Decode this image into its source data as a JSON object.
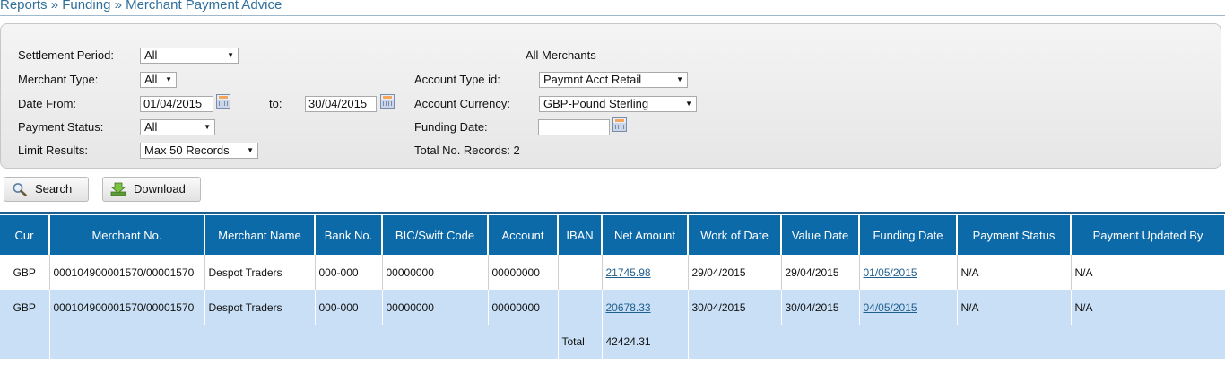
{
  "breadcrumb": "Reports » Funding » Merchant Payment Advice",
  "filters": {
    "settlement_period": {
      "label": "Settlement Period:",
      "value": "All"
    },
    "merchant_type": {
      "label": "Merchant Type:",
      "value": "All"
    },
    "date_from": {
      "label": "Date From:",
      "value": "01/04/2015"
    },
    "date_to": {
      "label": "to:",
      "value": "30/04/2015"
    },
    "payment_status": {
      "label": "Payment Status:",
      "value": "All"
    },
    "limit_results": {
      "label": "Limit Results:",
      "value": "Max 50 Records"
    },
    "all_merchants": "All Merchants",
    "account_type": {
      "label": "Account Type id:",
      "value": "Paymnt Acct Retail"
    },
    "account_currency": {
      "label": "Account Currency:",
      "value": "GBP-Pound Sterling"
    },
    "funding_date": {
      "label": "Funding Date:",
      "value": ""
    },
    "total_records": "Total No. Records: 2"
  },
  "buttons": {
    "search": "Search",
    "download": "Download"
  },
  "table": {
    "headers": [
      "Cur",
      "Merchant No.",
      "Merchant Name",
      "Bank No.",
      "BIC/Swift Code",
      "Account",
      "IBAN",
      "Net Amount",
      "Work of Date",
      "Value Date",
      "Funding Date",
      "Payment Status",
      "Payment Updated By"
    ],
    "rows": [
      {
        "cur": "GBP",
        "merchant_no": "000104900001570/00001570",
        "merchant_name": "Despot Traders",
        "bank_no": "000-000",
        "bic": "00000000",
        "account": "00000000",
        "iban": "",
        "net_amount": "21745.98",
        "work_date": "29/04/2015",
        "value_date": "29/04/2015",
        "funding_date": "01/05/2015",
        "status": "N/A",
        "updated_by": "N/A"
      },
      {
        "cur": "GBP",
        "merchant_no": "000104900001570/00001570",
        "merchant_name": "Despot Traders",
        "bank_no": "000-000",
        "bic": "00000000",
        "account": "00000000",
        "iban": "",
        "net_amount": "20678.33",
        "work_date": "30/04/2015",
        "value_date": "30/04/2015",
        "funding_date": "04/05/2015",
        "status": "N/A",
        "updated_by": "N/A"
      }
    ],
    "total_label": "Total",
    "total_value": "42424.31"
  }
}
